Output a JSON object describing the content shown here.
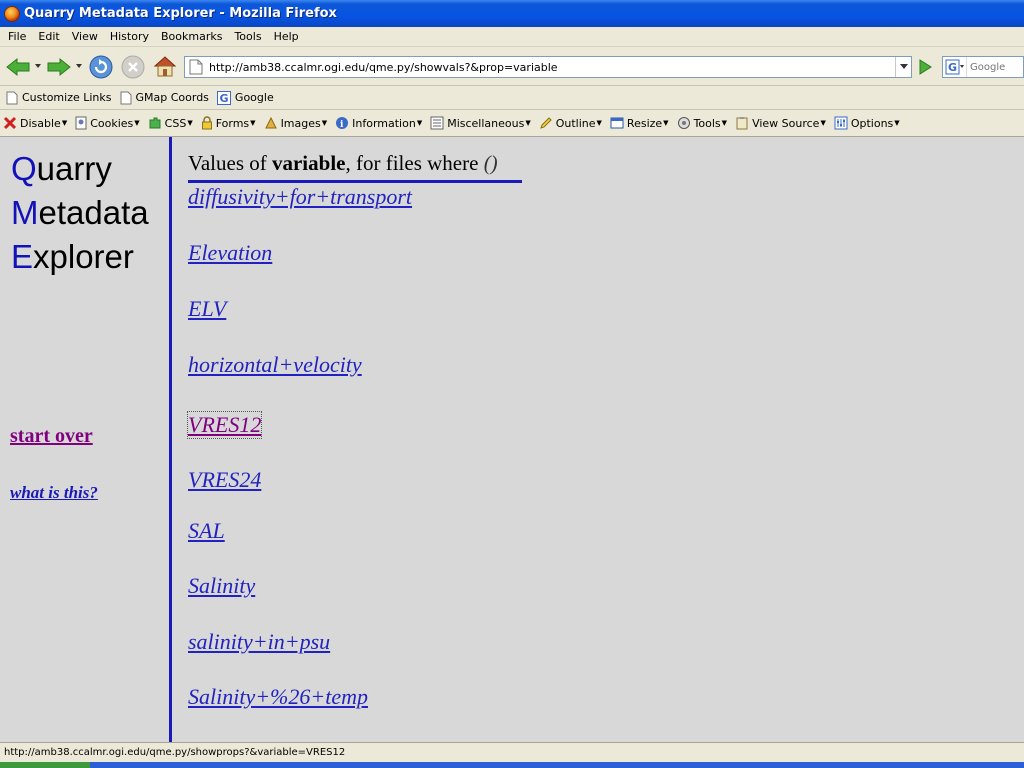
{
  "window": {
    "title": "Quarry Metadata Explorer - Mozilla Firefox"
  },
  "menubar": {
    "items": [
      "File",
      "Edit",
      "View",
      "History",
      "Bookmarks",
      "Tools",
      "Help"
    ]
  },
  "navbar": {
    "url": "http://amb38.ccalmr.ogi.edu/qme.py/showvals?&prop=variable",
    "search_placeholder": "Google"
  },
  "bookmarks": {
    "items": [
      "Customize Links",
      "GMap Coords",
      "Google"
    ]
  },
  "devtoolbar": {
    "items": [
      "Disable",
      "Cookies",
      "CSS",
      "Forms",
      "Images",
      "Information",
      "Miscellaneous",
      "Outline",
      "Resize",
      "Tools",
      "View Source",
      "Options"
    ]
  },
  "sidebar": {
    "logo_line1_cap": "Q",
    "logo_line1_rest": "uarry",
    "logo_line2_cap": "M",
    "logo_line2_rest": "etadata",
    "logo_line3_cap": "E",
    "logo_line3_rest": "xplorer",
    "start_over": "start over",
    "what_is_this": "what is this?"
  },
  "main": {
    "heading_prefix": "Values of ",
    "heading_prop": "variable",
    "heading_mid": ", for files where ",
    "heading_cond": "()",
    "values": [
      "diffusivity+for+transport",
      "Elevation",
      "ELV",
      "horizontal+velocity",
      "VRES12",
      "VRES24",
      "SAL",
      "Salinity",
      "salinity+in+psu",
      "Salinity+%26+temp"
    ]
  },
  "statusbar": {
    "text": "http://amb38.ccalmr.ogi.edu/qme.py/showprops?&variable=VRES12"
  },
  "colors": {
    "link": "#2222c0",
    "visited": "#800080",
    "accent": "#1a1ab8"
  }
}
